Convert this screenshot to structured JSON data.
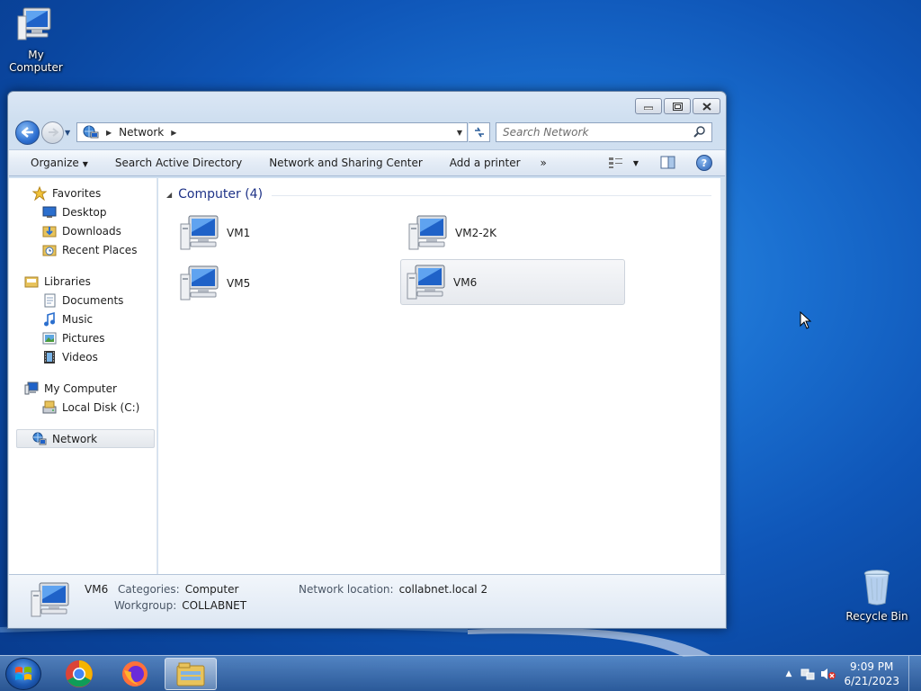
{
  "desktop": {
    "icons": [
      {
        "label": "My Computer"
      },
      {
        "label": "Recycle Bin"
      }
    ]
  },
  "window": {
    "address_segment": "Network",
    "search_placeholder": "Search Network",
    "toolbar": {
      "organize": "Organize",
      "search_ad": "Search Active Directory",
      "network_center": "Network and Sharing Center",
      "add_printer": "Add a printer",
      "more": "»"
    },
    "nav_pane": {
      "favorites": {
        "label": "Favorites",
        "items": [
          "Desktop",
          "Downloads",
          "Recent Places"
        ]
      },
      "libraries": {
        "label": "Libraries",
        "items": [
          "Documents",
          "Music",
          "Pictures",
          "Videos"
        ]
      },
      "computer": {
        "label": "My Computer",
        "items": [
          "Local Disk (C:)"
        ]
      },
      "network": {
        "label": "Network"
      }
    },
    "content": {
      "group_header": "Computer (4)",
      "computers": [
        "VM1",
        "VM2-2K",
        "VM5",
        "VM6"
      ],
      "selected": "VM6"
    },
    "details": {
      "name": "VM6",
      "categories_label": "Categories:",
      "categories_value": "Computer",
      "workgroup_label": "Workgroup:",
      "workgroup_value": "COLLABNET",
      "location_label": "Network location:",
      "location_value": "collabnet.local 2"
    }
  },
  "taskbar": {
    "apps": [
      "start-orb",
      "chrome-icon",
      "firefox-icon",
      "explorer-icon"
    ],
    "time": "9:09 PM",
    "date": "6/21/2023"
  }
}
